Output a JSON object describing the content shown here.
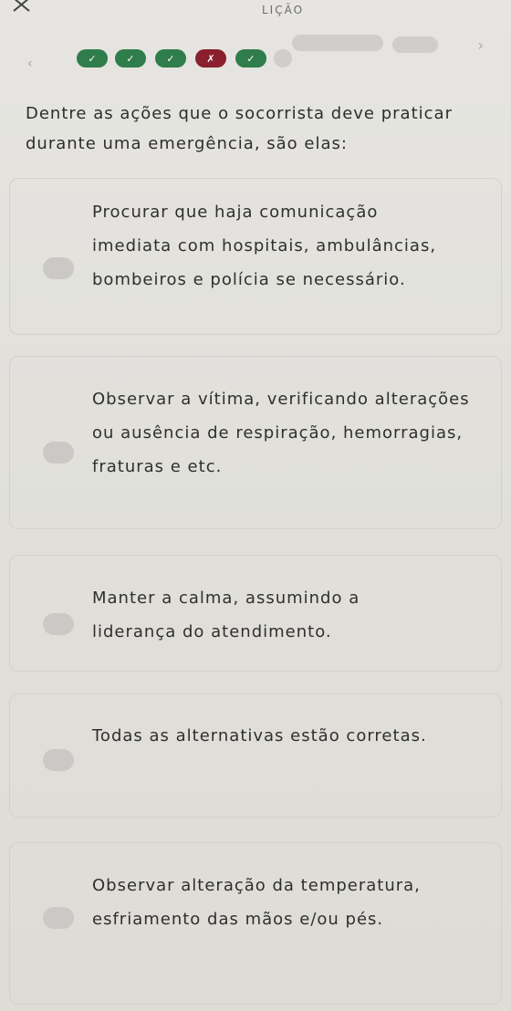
{
  "header": {
    "title": "LIÇÃO"
  },
  "progress": {
    "items": [
      {
        "state": "correct",
        "icon": "✓"
      },
      {
        "state": "correct",
        "icon": "✓"
      },
      {
        "state": "correct",
        "icon": "✓"
      },
      {
        "state": "wrong",
        "icon": "✗"
      },
      {
        "state": "correct",
        "icon": "✓"
      }
    ],
    "prev_icon": "‹",
    "next_icon": "›"
  },
  "question": {
    "text": "Dentre as ações que o socorrista deve praticar durante uma emergência, são elas:"
  },
  "options": [
    {
      "text": "Procurar que haja comunicação imediata com hospitais, ambulâncias, bombeiros e polícia se necessário."
    },
    {
      "text": "Observar a vítima, verificando alterações ou ausência de respiração, hemorragias, fraturas e etc."
    },
    {
      "text": "Manter a calma, assumindo a liderança do atendimento."
    },
    {
      "text": "Todas as alternativas estão corretas."
    },
    {
      "text": "Observar alteração da temperatura, esfriamento das mãos e/ou pés."
    }
  ]
}
